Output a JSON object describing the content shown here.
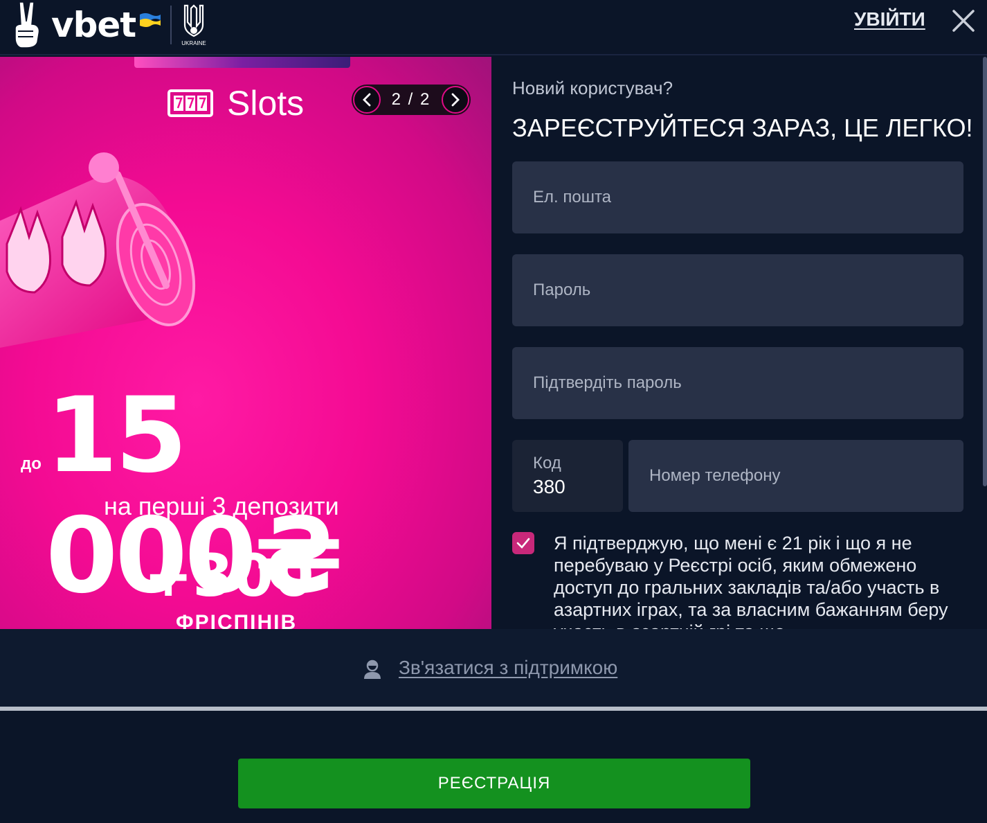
{
  "header": {
    "brand": "vbet",
    "emblem_label": "UKRAINE",
    "login_label": "УВІЙТИ"
  },
  "promo": {
    "category": "Slots",
    "slider_position": "2 / 2",
    "amount_prefix": "до",
    "amount": "15 000₴",
    "amount_sub": "на перші 3 депозити",
    "bonus": "+300",
    "bonus_sub": "ФРІСПІНІВ"
  },
  "form": {
    "subtitle": "Новий користувач?",
    "title": "ЗАРЕЄСТРУЙТЕСЯ ЗАРАЗ, ЦЕ ЛЕГКО!",
    "email_placeholder": "Ел. пошта",
    "password_placeholder": "Пароль",
    "confirm_placeholder": "Підтвердіть пароль",
    "code_label": "Код",
    "code_value": "380",
    "phone_placeholder": "Номер телефону",
    "consent_checked": true,
    "consent_text": "Я підтверджую, що мені є 21 рік і що я не перебуваю у Реєстрі осіб, яким обмежено доступ до гральних закладів та/або участь в азартних іграх, та за власним бажанням беру участь в азартній грі та що"
  },
  "support": {
    "label": "Зв'язатися з підтримкою"
  },
  "footer": {
    "register_label": "РЕЄСТРАЦІЯ"
  },
  "colors": {
    "background": "#0b1528",
    "field": "#283147",
    "promo_pink": "#f40b93",
    "checkbox": "#c8287a",
    "register_green": "#14911f"
  },
  "icons": [
    "victory-hand-icon",
    "ukraine-flag-icon",
    "trident-emblem-icon",
    "close-icon",
    "slot-777-icon",
    "chevron-left-icon",
    "chevron-right-icon",
    "checkmark-icon",
    "support-agent-icon"
  ]
}
